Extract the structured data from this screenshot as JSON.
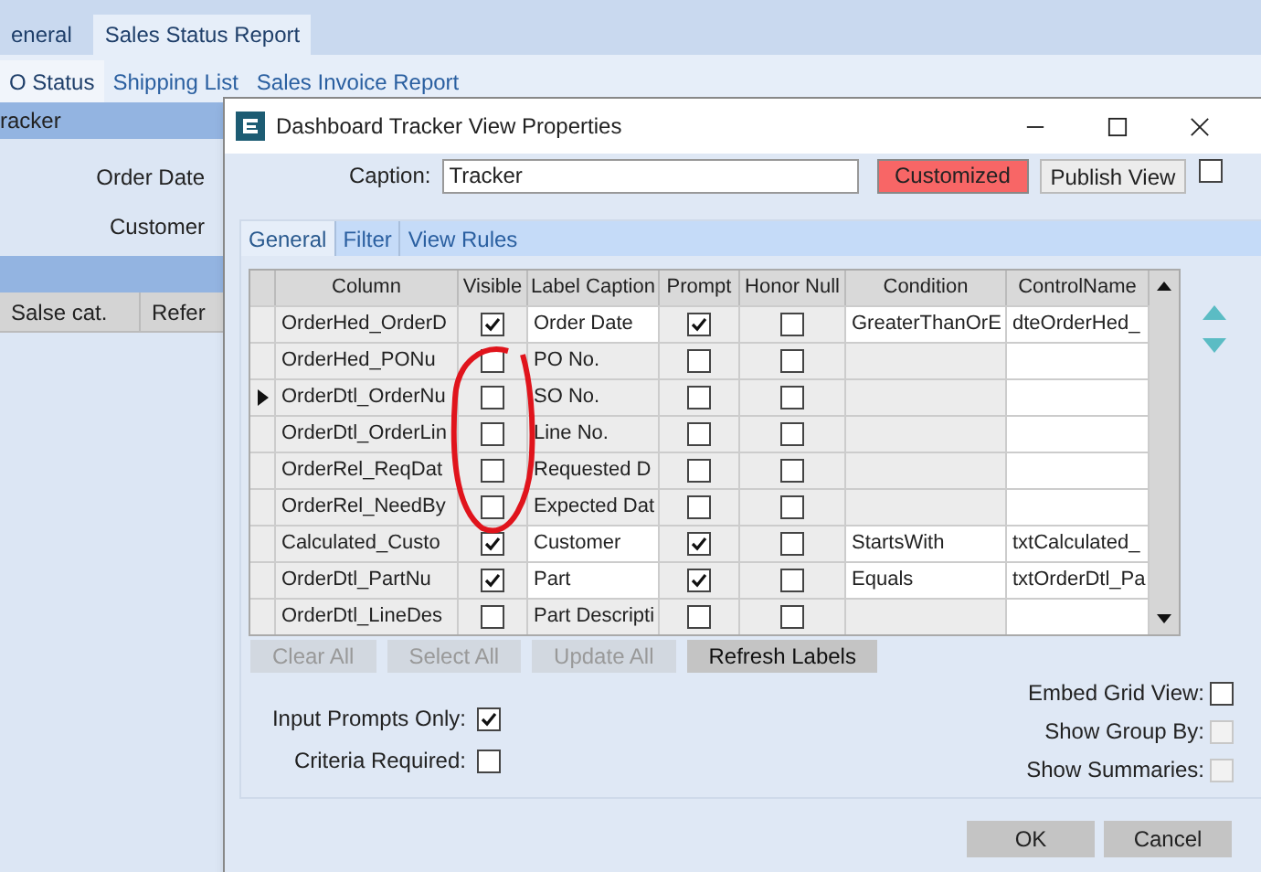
{
  "app": {
    "tabs": [
      {
        "label": "eneral",
        "selected": false
      },
      {
        "label": "Sales Status Report",
        "selected": true
      }
    ],
    "subtabs": [
      {
        "label": "O Status",
        "selected": true
      },
      {
        "label": "Shipping List",
        "selected": false
      },
      {
        "label": "Sales Invoice Report",
        "selected": false
      }
    ],
    "panel_title": "racker",
    "fields": [
      {
        "label": "Order Date"
      },
      {
        "label": "Customer"
      }
    ],
    "grid_columns": [
      "Salse cat.",
      "Refer"
    ]
  },
  "dialog": {
    "title": "Dashboard Tracker View Properties",
    "caption_label": "Caption:",
    "caption_value": "Tracker",
    "status_badge": "Customized",
    "publish_button": "Publish View",
    "publish_checked": false,
    "tabs": [
      {
        "label": "General",
        "selected": true
      },
      {
        "label": "Filter",
        "selected": false
      },
      {
        "label": "View Rules",
        "selected": false
      }
    ],
    "columns": [
      "Column",
      "Visible",
      "Label Caption",
      "Prompt",
      "Honor Null",
      "Condition",
      "ControlName"
    ],
    "rows": [
      {
        "column": "OrderHed_OrderD",
        "visible": true,
        "label": "Order Date",
        "prompt": true,
        "honor_null": false,
        "condition": "GreaterThanOrE",
        "control": "dteOrderHed_",
        "current": false
      },
      {
        "column": "OrderHed_PONu",
        "visible": false,
        "label": "PO No.",
        "prompt": false,
        "honor_null": false,
        "current": false
      },
      {
        "column": "OrderDtl_OrderNu",
        "visible": false,
        "label": "SO No.",
        "prompt": false,
        "honor_null": false,
        "current": true
      },
      {
        "column": "OrderDtl_OrderLin",
        "visible": false,
        "label": "Line No.",
        "prompt": false,
        "honor_null": false,
        "current": false
      },
      {
        "column": "OrderRel_ReqDat",
        "visible": false,
        "label": "Requested D",
        "prompt": false,
        "honor_null": false,
        "current": false
      },
      {
        "column": "OrderRel_NeedBy",
        "visible": false,
        "label": "Expected Dat",
        "prompt": false,
        "honor_null": false,
        "current": false
      },
      {
        "column": "Calculated_Custo",
        "visible": true,
        "label": "Customer",
        "prompt": true,
        "honor_null": false,
        "condition": "StartsWith",
        "control": "txtCalculated_",
        "current": false
      },
      {
        "column": "OrderDtl_PartNu",
        "visible": true,
        "label": "Part",
        "prompt": true,
        "honor_null": false,
        "condition": "Equals",
        "control": "txtOrderDtl_Pa",
        "current": false
      },
      {
        "column": "OrderDtl_LineDes",
        "visible": false,
        "label": "Part Descripti",
        "prompt": false,
        "honor_null": false,
        "current": false
      }
    ],
    "grid_buttons": [
      {
        "label": "Clear All",
        "disabled": true
      },
      {
        "label": "Select All",
        "disabled": true
      },
      {
        "label": "Update All",
        "disabled": true
      },
      {
        "label": "Refresh Labels",
        "disabled": false
      }
    ],
    "left_options": [
      {
        "label": "Input Prompts Only:",
        "checked": true,
        "disabled": false
      },
      {
        "label": "Criteria Required:",
        "checked": false,
        "disabled": false
      }
    ],
    "right_options": [
      {
        "label": "Embed Grid View:",
        "checked": false,
        "disabled": false
      },
      {
        "label": "Show Group By:",
        "checked": false,
        "disabled": true
      },
      {
        "label": "Show Summaries:",
        "checked": false,
        "disabled": true
      }
    ],
    "ok_button": "OK",
    "cancel_button": "Cancel"
  }
}
